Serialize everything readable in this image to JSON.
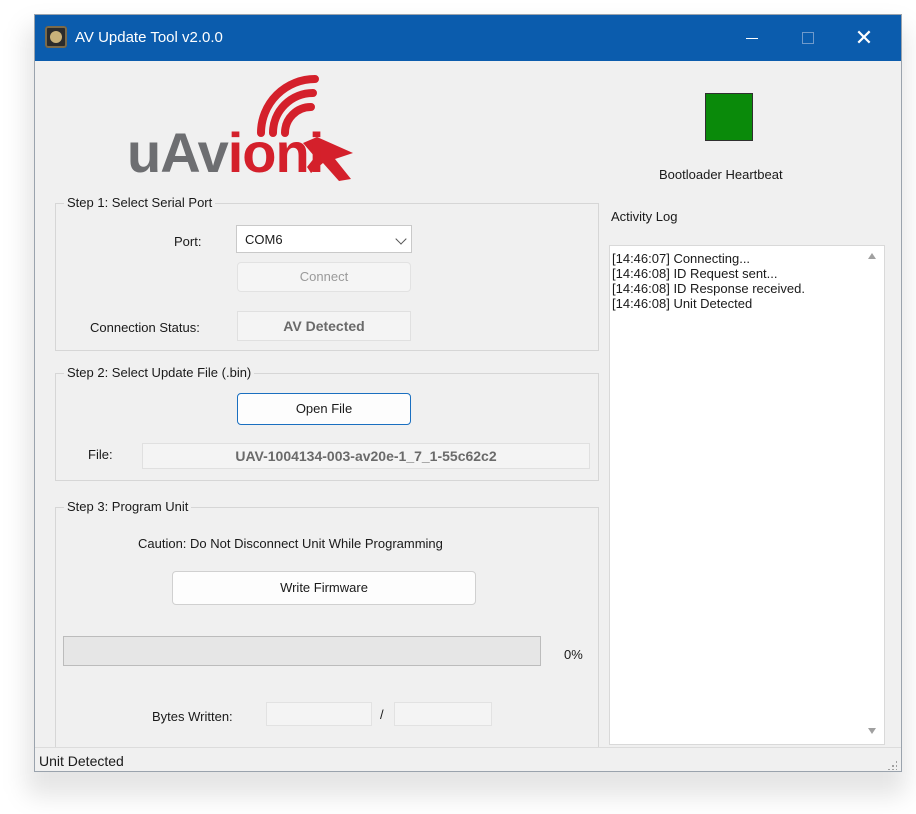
{
  "window": {
    "title": "AV Update Tool v2.0.0",
    "minimize_glyph": "—",
    "maximize_glyph": "☐",
    "close_glyph": "✕",
    "title_bar_color": "#0b5cad"
  },
  "logo": {
    "prefix": "uAv",
    "rest": "ioni",
    "brand_gray": "#6d6e71",
    "brand_red": "#d4202b"
  },
  "step1": {
    "title": "Step 1: Select Serial Port",
    "port_label": "Port:",
    "port_value": "COM6",
    "connect_label": "Connect",
    "status_label": "Connection Status:",
    "status_value": "AV Detected"
  },
  "step2": {
    "title": "Step 2: Select Update File (.bin)",
    "open_label": "Open File",
    "file_label": "File:",
    "file_value": "UAV-1004134-003-av20e-1_7_1-55c62c2"
  },
  "step3": {
    "title": "Step 3: Program Unit",
    "caution": "Caution: Do Not Disconnect Unit While Programming",
    "write_label": "Write Firmware",
    "progress_value": 0,
    "progress_text": "0%",
    "bytes_label": "Bytes Written:",
    "bytes_separator": "/",
    "bytes_written": "",
    "bytes_total": ""
  },
  "heartbeat": {
    "label": "Bootloader Heartbeat",
    "color": "#0a8a0a"
  },
  "activity": {
    "title": "Activity Log",
    "lines": [
      "[14:46:07] Connecting...",
      "[14:46:08] ID Request sent...",
      "[14:46:08] ID Response received.",
      "[14:46:08] Unit Detected"
    ]
  },
  "statusbar": {
    "text": "Unit Detected"
  }
}
